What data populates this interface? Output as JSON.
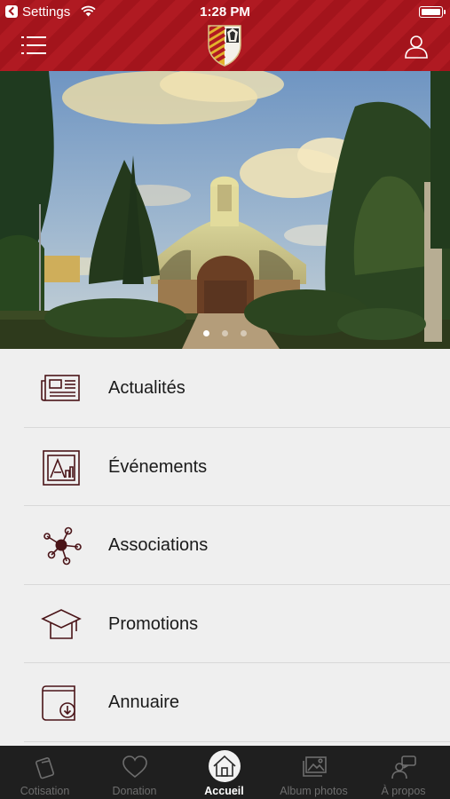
{
  "status_bar": {
    "back_app": "Settings",
    "time": "1:28 PM"
  },
  "header": {
    "menu_icon": "hamburger-icon",
    "logo_icon": "crest-logo",
    "profile_icon": "user-icon",
    "accent_color": "#a3141c"
  },
  "carousel": {
    "page_count": 3,
    "active_index": 0
  },
  "menu": {
    "items": [
      {
        "label": "Actualités",
        "icon": "newspaper-icon"
      },
      {
        "label": "Événements",
        "icon": "event-picture-icon"
      },
      {
        "label": "Associations",
        "icon": "network-icon"
      },
      {
        "label": "Promotions",
        "icon": "graduation-cap-icon"
      },
      {
        "label": "Annuaire",
        "icon": "directory-book-icon"
      }
    ],
    "icon_color": "#4a1418"
  },
  "tabbar": {
    "tabs": [
      {
        "label": "Cotisation",
        "icon": "card-icon",
        "active": false
      },
      {
        "label": "Donation",
        "icon": "heart-icon",
        "active": false
      },
      {
        "label": "Accueil",
        "icon": "home-icon",
        "active": true
      },
      {
        "label": "Album photos",
        "icon": "photo-album-icon",
        "active": false
      },
      {
        "label": "À propos",
        "icon": "info-person-icon",
        "active": false
      }
    ]
  }
}
